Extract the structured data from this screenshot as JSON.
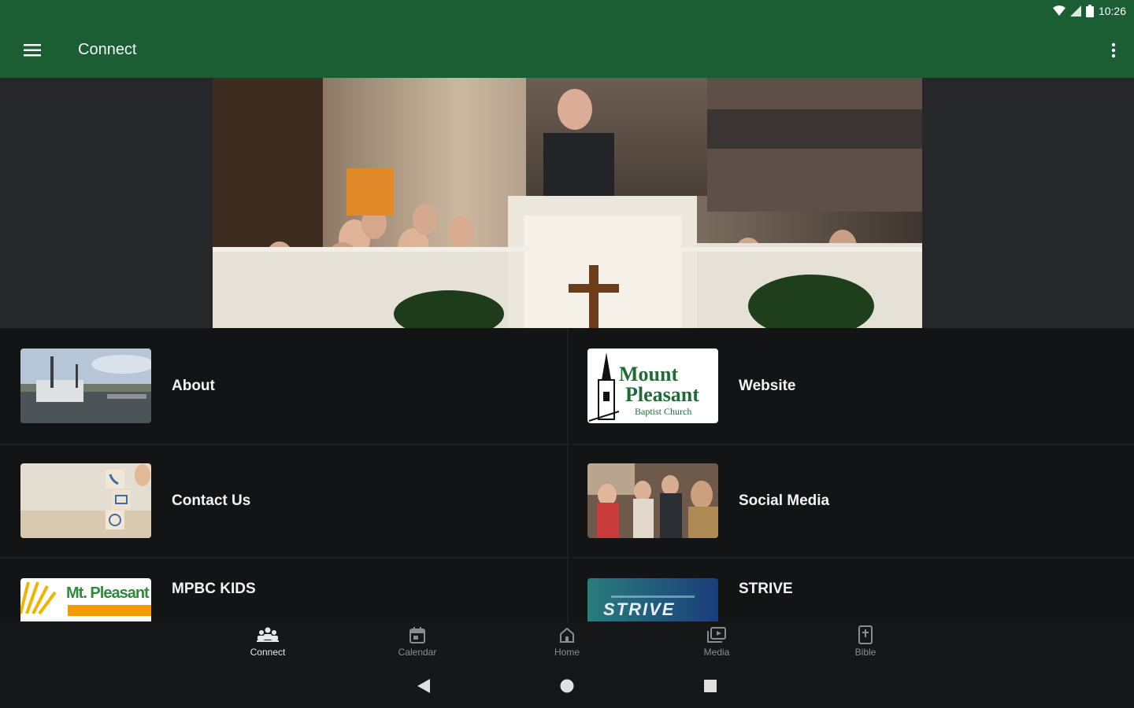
{
  "status_bar": {
    "time": "10:26",
    "icons": [
      "wifi-icon",
      "signal-icon",
      "battery-icon"
    ]
  },
  "app_bar": {
    "title": "Connect",
    "menu_icon": "hamburger-icon",
    "overflow_icon": "more-vert-icon"
  },
  "hero": {
    "image": "church-congregation-photo"
  },
  "tiles": [
    {
      "label": "About",
      "thumb": "harbor-photo"
    },
    {
      "label": "Website",
      "thumb": "mount-pleasant-logo",
      "logo_lines": [
        "Mount",
        "Pleasant",
        "Baptist Church"
      ]
    },
    {
      "label": "Contact Us",
      "thumb": "contact-blocks-photo"
    },
    {
      "label": "Social Media",
      "thumb": "fellowship-photo"
    },
    {
      "label": "MPBC KIDS",
      "thumb": "kids-logo",
      "logo_text": "Mt. Pleasant"
    },
    {
      "label": "STRIVE",
      "thumb": "strive-logo",
      "logo_text": "STRIVE"
    }
  ],
  "bottom_nav": [
    {
      "label": "Connect",
      "icon": "people-icon",
      "active": true
    },
    {
      "label": "Calendar",
      "icon": "calendar-icon",
      "active": false
    },
    {
      "label": "Home",
      "icon": "home-icon",
      "active": false
    },
    {
      "label": "Media",
      "icon": "media-icon",
      "active": false
    },
    {
      "label": "Bible",
      "icon": "bible-icon",
      "active": false
    }
  ],
  "system_nav": [
    "back-icon",
    "home-circle-icon",
    "recents-icon"
  ],
  "colors": {
    "app_bar": "#1b5e34",
    "background": "#121416",
    "hero_band": "#262728"
  }
}
